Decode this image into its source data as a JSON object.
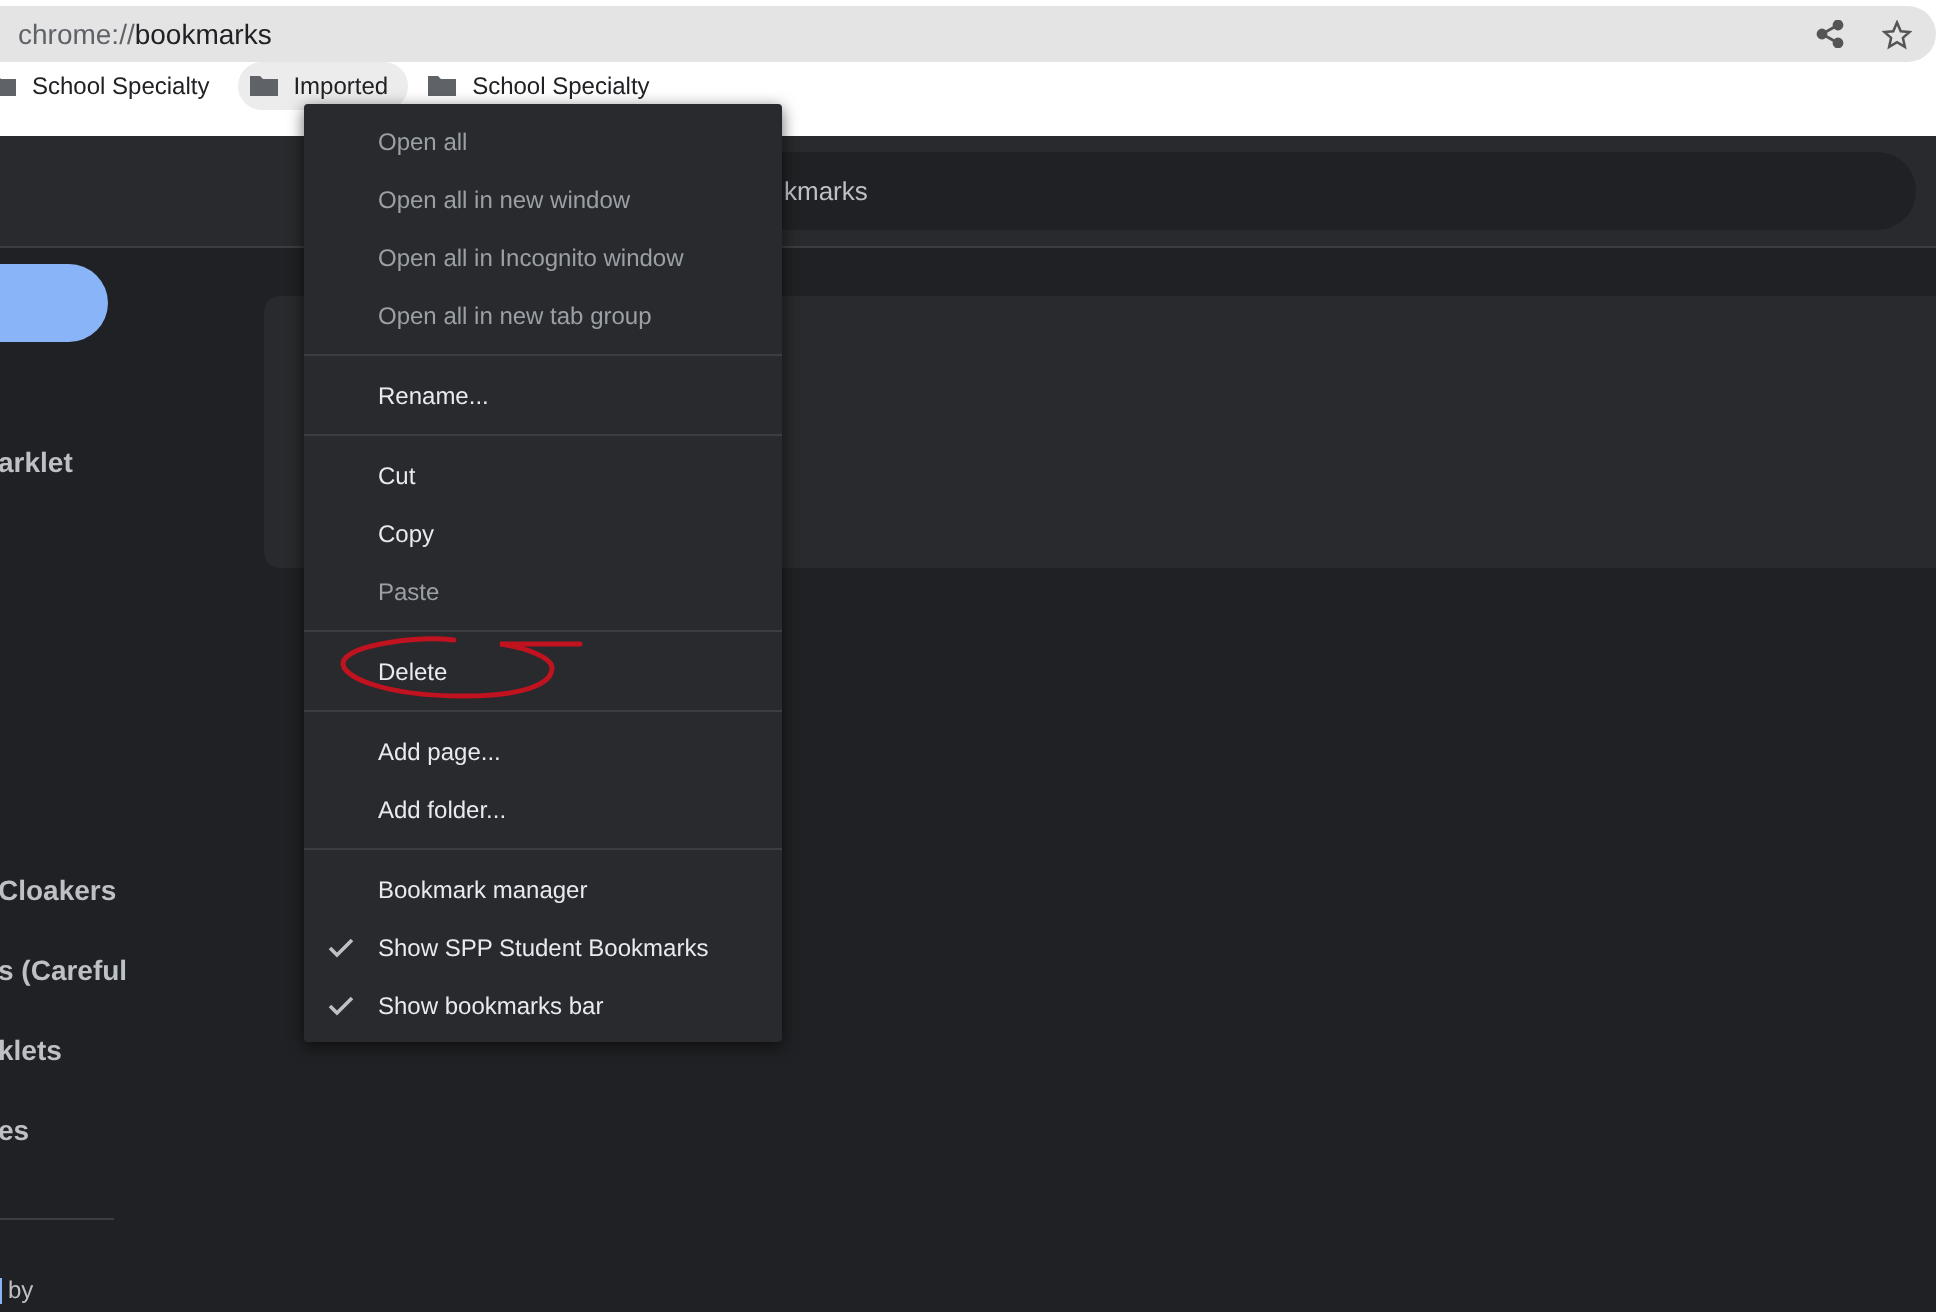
{
  "address_bar": {
    "scheme": "chrome://",
    "host": "bookmarks"
  },
  "bookmarks_bar": [
    {
      "label": "School Specialty",
      "hovered": false
    },
    {
      "label": "Imported",
      "hovered": true
    },
    {
      "label": "School Specialty",
      "hovered": false
    }
  ],
  "search": {
    "value": "kmarks"
  },
  "sidebar": {
    "items": [
      "arklet",
      "Cloakers",
      "s (Careful",
      "klets",
      "es"
    ],
    "footer": "by"
  },
  "context_menu": [
    [
      {
        "label": "Open all",
        "disabled": true,
        "checked": false,
        "circled": false
      },
      {
        "label": "Open all in new window",
        "disabled": true,
        "checked": false,
        "circled": false
      },
      {
        "label": "Open all in Incognito window",
        "disabled": true,
        "checked": false,
        "circled": false
      },
      {
        "label": "Open all in new tab group",
        "disabled": true,
        "checked": false,
        "circled": false
      }
    ],
    [
      {
        "label": "Rename...",
        "disabled": false,
        "checked": false,
        "circled": false
      }
    ],
    [
      {
        "label": "Cut",
        "disabled": false,
        "checked": false,
        "circled": false
      },
      {
        "label": "Copy",
        "disabled": false,
        "checked": false,
        "circled": false
      },
      {
        "label": "Paste",
        "disabled": true,
        "checked": false,
        "circled": false
      }
    ],
    [
      {
        "label": "Delete",
        "disabled": false,
        "checked": false,
        "circled": true
      }
    ],
    [
      {
        "label": "Add page...",
        "disabled": false,
        "checked": false,
        "circled": false
      },
      {
        "label": "Add folder...",
        "disabled": false,
        "checked": false,
        "circled": false
      }
    ],
    [
      {
        "label": "Bookmark manager",
        "disabled": false,
        "checked": false,
        "circled": false
      },
      {
        "label": "Show SPP Student Bookmarks",
        "disabled": false,
        "checked": true,
        "circled": false
      },
      {
        "label": "Show bookmarks bar",
        "disabled": false,
        "checked": true,
        "circled": false
      }
    ]
  ]
}
